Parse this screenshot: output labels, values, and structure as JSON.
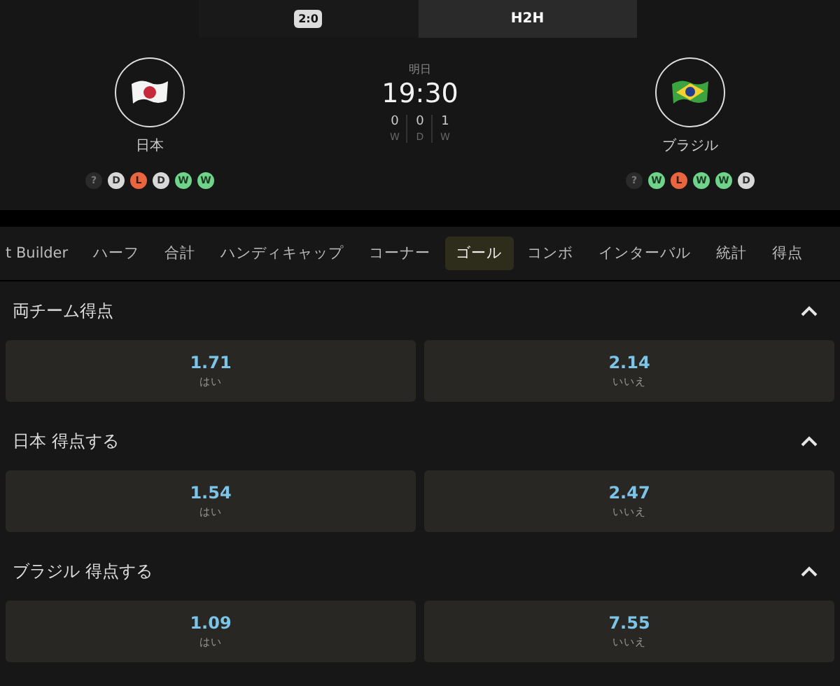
{
  "top_tabs": [
    {
      "label": "2:0",
      "kind": "badge",
      "selected": false
    },
    {
      "label": "H2H",
      "kind": "text",
      "selected": true
    }
  ],
  "match": {
    "day": "明日",
    "time": "19:30",
    "stats": [
      {
        "value": "0",
        "label": "W"
      },
      {
        "value": "0",
        "label": "D"
      },
      {
        "value": "1",
        "label": "W"
      }
    ],
    "teams": [
      {
        "name": "日本",
        "kind": "japan",
        "form": [
          {
            "label": "?",
            "kind": "unknown"
          },
          {
            "label": "D",
            "kind": "draw"
          },
          {
            "label": "L",
            "kind": "loss"
          },
          {
            "label": "D",
            "kind": "draw"
          },
          {
            "label": "W",
            "kind": "win"
          },
          {
            "label": "W",
            "kind": "win"
          }
        ]
      },
      {
        "name": "ブラジル",
        "kind": "brazil",
        "form": [
          {
            "label": "?",
            "kind": "unknown"
          },
          {
            "label": "W",
            "kind": "win"
          },
          {
            "label": "L",
            "kind": "loss"
          },
          {
            "label": "W",
            "kind": "win"
          },
          {
            "label": "W",
            "kind": "win"
          },
          {
            "label": "D",
            "kind": "draw"
          }
        ]
      }
    ]
  },
  "market_tabs": [
    {
      "label": "t Builder",
      "selected": false
    },
    {
      "label": "ハーフ",
      "selected": false
    },
    {
      "label": "合計",
      "selected": false
    },
    {
      "label": "ハンディキャップ",
      "selected": false
    },
    {
      "label": "コーナー",
      "selected": false
    },
    {
      "label": "ゴール",
      "selected": true
    },
    {
      "label": "コンボ",
      "selected": false
    },
    {
      "label": "インターバル",
      "selected": false
    },
    {
      "label": "統計",
      "selected": false
    },
    {
      "label": "得点",
      "selected": false
    }
  ],
  "markets": [
    {
      "title": "両チーム得点",
      "expanded": true,
      "odds": [
        {
          "price": "1.71",
          "label": "はい"
        },
        {
          "price": "2.14",
          "label": "いいえ"
        }
      ]
    },
    {
      "title": "日本 得点する",
      "expanded": true,
      "odds": [
        {
          "price": "1.54",
          "label": "はい"
        },
        {
          "price": "2.47",
          "label": "いいえ"
        }
      ]
    },
    {
      "title": "ブラジル 得点する",
      "expanded": true,
      "odds": [
        {
          "price": "1.09",
          "label": "はい"
        },
        {
          "price": "7.55",
          "label": "いいえ"
        }
      ]
    }
  ]
}
